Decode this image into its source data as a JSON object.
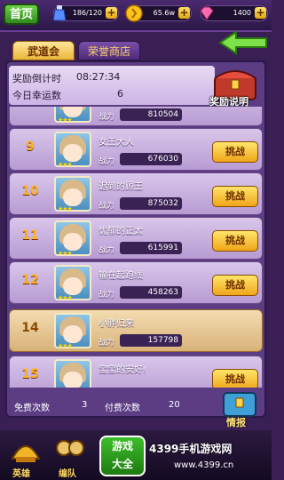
{
  "header": {
    "home_label": "首页",
    "resources": [
      {
        "name": "stamina",
        "value": "186/120",
        "icon": "stamina-potion-icon",
        "color": "#7fb0ff"
      },
      {
        "name": "gold",
        "value": "65.6w",
        "icon": "gold-coin-icon",
        "color": "#ffc21a"
      },
      {
        "name": "diamond",
        "value": "1400",
        "icon": "diamond-icon",
        "color": "#ff5fa8"
      }
    ]
  },
  "tabs": [
    {
      "label": "武道会",
      "active": true
    },
    {
      "label": "荣誉商店",
      "active": false
    }
  ],
  "info": {
    "countdown_label": "奖励倒计时",
    "countdown_value": "08:27:34",
    "lucky_label": "今日幸运数",
    "lucky_value": "6",
    "reward_label": "奖励说明"
  },
  "list": {
    "power_label": "战力",
    "challenge_label": "挑战",
    "rows": [
      {
        "rank": "",
        "name": "",
        "power": "810504",
        "mine": false,
        "challenge": false
      },
      {
        "rank": "9",
        "name": "女王大人",
        "power": "676030",
        "mine": false,
        "challenge": true
      },
      {
        "rank": "10",
        "name": "迟到的顾王",
        "power": "875032",
        "mine": false,
        "challenge": true
      },
      {
        "rank": "11",
        "name": "忧郁的正太",
        "power": "615991",
        "mine": false,
        "challenge": true
      },
      {
        "rank": "12",
        "name": "输在起跑线",
        "power": "458263",
        "mine": false,
        "challenge": true
      },
      {
        "rank": "14",
        "name": "小胖归来",
        "power": "157798",
        "mine": true,
        "challenge": false
      },
      {
        "rank": "15",
        "name": "宝宝的安好!",
        "power": "",
        "mine": false,
        "challenge": true
      }
    ]
  },
  "footer": {
    "free_label": "免费次数",
    "free_value": "3",
    "paid_label": "付费次数",
    "paid_value": "20",
    "intel_label": "情报"
  },
  "bottom_nav": [
    {
      "label": "英雄",
      "icon": "hero-helmet-icon"
    },
    {
      "label": "编队",
      "icon": "formation-icon"
    }
  ],
  "watermark": {
    "logo_text_1": "游戏",
    "logo_text_2": "大全",
    "text": "4399手机游戏网",
    "url": "www.4399.cn"
  }
}
